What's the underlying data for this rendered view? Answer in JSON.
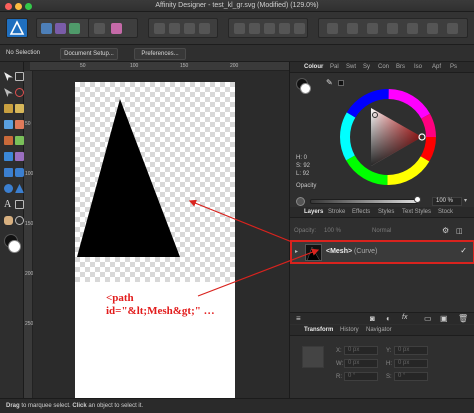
{
  "window": {
    "title": "Affinity Designer - test_kl_gr.svg (Modified) (129.0%)"
  },
  "context_toolbar": {
    "selection_label": "No Selection",
    "document_setup": "Document Setup...",
    "preferences": "Preferences..."
  },
  "rulers": {
    "top": [
      "50",
      "100",
      "150",
      "200"
    ],
    "left": [
      "50",
      "100",
      "150",
      "200",
      "250"
    ]
  },
  "colour_panel": {
    "tabs": [
      "Colour",
      "Pal",
      "Swt",
      "Sy",
      "Con",
      "Brs",
      "Iso",
      "Apf",
      "Ps"
    ],
    "hue_label": "H: 0",
    "sat_label": "S: 92",
    "lum_label": "L: 92",
    "opacity_label": "Opacity",
    "opacity_value": "100 %",
    "opacity_fraction": 1.0
  },
  "layers_panel": {
    "tabs": [
      "Layers",
      "Stroke",
      "Effects",
      "Styles",
      "Text Styles",
      "Stock"
    ],
    "opacity_label": "Opacity:",
    "opacity_value": "100 %",
    "blend_mode": "Normal",
    "layer": {
      "name": "<Mesh>",
      "type": "(Curve)",
      "visible_check": "✓"
    }
  },
  "transform_panel": {
    "tabs": [
      "Transform",
      "History",
      "Navigator"
    ],
    "x_label": "X:",
    "x_value": "0 px",
    "y_label": "Y:",
    "y_value": "0 px",
    "w_label": "W:",
    "w_value": "0 px",
    "h_label": "H:",
    "h_value": "0 px",
    "r_label": "R:",
    "r_value": "0 °",
    "s_label": "S:",
    "s_value": "0 °"
  },
  "canvas_annotation": {
    "line1": "<path",
    "line2": "id=\"&lt;Mesh&gt;\" …"
  },
  "status_bar": {
    "drag_word": "Drag",
    "drag_rest": " to marquee select. ",
    "click_word": "Click",
    "click_rest": " an object to select it."
  },
  "colors": {
    "accent_red": "#d9231e",
    "panel_bg": "#2f2f2f",
    "toolbar_bg": "#333333"
  }
}
